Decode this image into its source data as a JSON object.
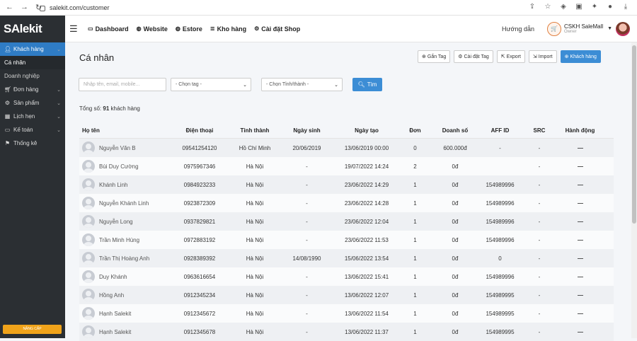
{
  "browser": {
    "url": "salekit.com/customer"
  },
  "sidebar": {
    "logo": "SAlekit",
    "items": [
      {
        "label": "Khách hàng",
        "icon": "user-icon",
        "active": true,
        "chevron": "⌄"
      },
      {
        "label": "Đơn hàng",
        "icon": "cart-icon",
        "chevron": "⌄"
      },
      {
        "label": "Sản phẩm",
        "icon": "gift-icon",
        "chevron": "⌄"
      },
      {
        "label": "Lịch hẹn",
        "icon": "calendar-icon",
        "chevron": "⌄"
      },
      {
        "label": "Kế toán",
        "icon": "money-icon",
        "chevron": "⌄"
      },
      {
        "label": "Thống kê",
        "icon": "flag-icon"
      }
    ],
    "subitems": [
      "Cá nhân",
      "Doanh nghiệp"
    ],
    "upgrade_label": "NÂNG CẤP"
  },
  "topbar": {
    "nav": [
      {
        "label": "Dashboard",
        "icon": "monitor-icon"
      },
      {
        "label": "Website",
        "icon": "globe-icon"
      },
      {
        "label": "Estore",
        "icon": "globe-icon"
      },
      {
        "label": "Kho hàng",
        "icon": "stack-icon"
      },
      {
        "label": "Cài đặt Shop",
        "icon": "gear-icon"
      }
    ],
    "guide": "Hướng dẫn",
    "account_name": "CSKH SaleMall",
    "account_role": "Owner"
  },
  "page": {
    "title": "Cá nhân",
    "actions": [
      {
        "label": "Gắn Tag",
        "icon": "plus-icon"
      },
      {
        "label": "Cài đặt Tag",
        "icon": "gear-icon"
      },
      {
        "label": "Export",
        "icon": "export-icon"
      },
      {
        "label": "Import",
        "icon": "import-icon"
      },
      {
        "label": "Khách hàng",
        "icon": "plus-icon",
        "primary": true
      }
    ],
    "search_placeholder": "Nhập tên, email, mobile...",
    "tag_select": "- Chọn tag -",
    "province_select": "- Chọn Tỉnh/thành -",
    "search_button": "Tìm",
    "total_prefix": "Tổng số:",
    "total_count": "91",
    "total_suffix": "khách hàng"
  },
  "table": {
    "headers": [
      "Họ tên",
      "Điện thoại",
      "Tỉnh thành",
      "Ngày sinh",
      "Ngày tạo",
      "Đơn",
      "Doanh số",
      "AFF ID",
      "SRC",
      "Hành động"
    ],
    "rows": [
      [
        "Nguyễn Văn B",
        "09541254120",
        "Hồ Chí Minh",
        "20/06/2019",
        "13/06/2019 00:00",
        "0",
        "600.000đ",
        "-",
        "-",
        "—"
      ],
      [
        "Bùi Duy Cường",
        "0975967346",
        "Hà Nội",
        "-",
        "19/07/2022 14:24",
        "2",
        "0đ",
        "",
        "-",
        "—"
      ],
      [
        "Khánh Linh",
        "0984923233",
        "Hà Nội",
        "-",
        "23/06/2022 14:29",
        "1",
        "0đ",
        "154989996",
        "-",
        "—"
      ],
      [
        "Nguyễn Khánh Linh",
        "0923872309",
        "Hà Nội",
        "-",
        "23/06/2022 14:28",
        "1",
        "0đ",
        "154989996",
        "-",
        "—"
      ],
      [
        "Nguyễn Long",
        "0937829821",
        "Hà Nội",
        "-",
        "23/06/2022 12:04",
        "1",
        "0đ",
        "154989996",
        "-",
        "—"
      ],
      [
        "Trần Minh Hùng",
        "0972883192",
        "Hà Nội",
        "-",
        "23/06/2022 11:53",
        "1",
        "0đ",
        "154989996",
        "-",
        "—"
      ],
      [
        "Trần Thị Hoàng Anh",
        "0928389392",
        "Hà Nội",
        "14/08/1990",
        "15/06/2022 13:54",
        "1",
        "0đ",
        "0",
        "-",
        "—"
      ],
      [
        "Duy Khánh",
        "0963616654",
        "Hà Nội",
        "-",
        "13/06/2022 15:41",
        "1",
        "0đ",
        "154989996",
        "-",
        "—"
      ],
      [
        "Hồng Anh",
        "0912345234",
        "Hà Nội",
        "-",
        "13/06/2022 12:07",
        "1",
        "0đ",
        "154989995",
        "-",
        "—"
      ],
      [
        "Hạnh Salekit",
        "0912345672",
        "Hà Nội",
        "-",
        "13/06/2022 11:54",
        "1",
        "0đ",
        "154989995",
        "-",
        "—"
      ],
      [
        "Hạnh Salekit",
        "0912345678",
        "Hà Nội",
        "-",
        "13/06/2022 11:37",
        "1",
        "0đ",
        "154989995",
        "-",
        "—"
      ]
    ]
  },
  "colors": {
    "sidebar_bg": "#2b2f33",
    "accent": "#3c8dd5",
    "upgrade": "#f0a31a"
  }
}
